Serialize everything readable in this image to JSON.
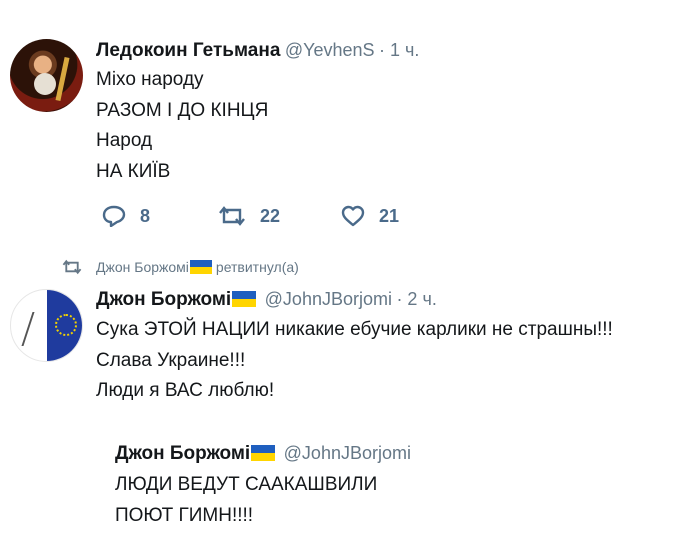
{
  "tweet1": {
    "author_name": "Ледокоин Гетьмана",
    "author_handle": "@YevhenS",
    "time": "· 1 ч.",
    "lines": [
      "Міхо народу",
      "РАЗОМ І ДО КІНЦЯ",
      "Народ",
      "НА КИЇВ"
    ],
    "replies": "8",
    "retweets": "22",
    "likes": "21"
  },
  "retweet_notice": {
    "user": "Джон Боржомі",
    "action": "ретвитнул(а)"
  },
  "tweet2": {
    "author_name": "Джон Боржомі",
    "author_handle": "@JohnJBorjomi",
    "time": "· 2 ч.",
    "lines": [
      "Сука ЭТОЙ НАЦИИ никакие ебучие карлики не страшны!!!",
      "Слава Украине!!!",
      "Люди я ВАС люблю!"
    ]
  },
  "quoted": {
    "author_name": "Джон Боржомі",
    "author_handle": "@JohnJBorjomi",
    "lines": [
      "ЛЮДИ ВЕДУТ СААКАШВИЛИ",
      "ПОЮТ ГИМН!!!!"
    ]
  },
  "icons": [
    "reply-icon",
    "retweet-icon",
    "like-icon",
    "flag-ukraine-icon"
  ],
  "colors": {
    "flag_blue": "#1f5fbf",
    "flag_yellow": "#ffd500",
    "muted": "#657786"
  }
}
